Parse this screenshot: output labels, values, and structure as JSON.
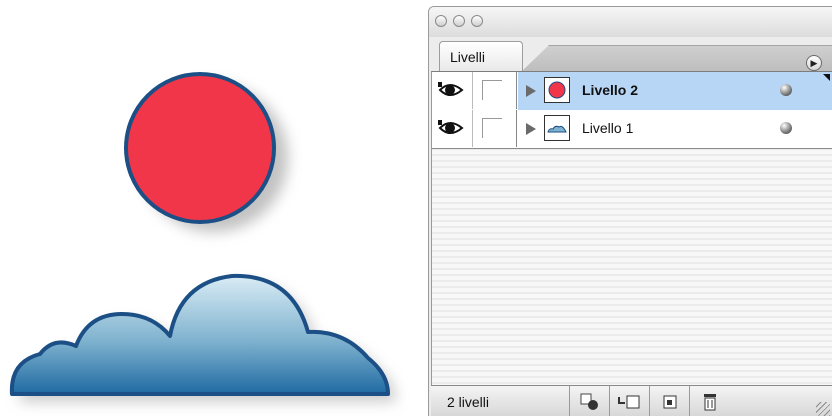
{
  "panel": {
    "tab_label": "Livelli",
    "layers": [
      {
        "name": "Livello 2",
        "selected": true,
        "thumbnail": "red-circle-icon",
        "visible": true
      },
      {
        "name": "Livello 1",
        "selected": false,
        "thumbnail": "cloud-icon",
        "visible": true
      }
    ],
    "status_count": "2 livelli",
    "footer_buttons": [
      "selection-target-icon",
      "new-layer-from-icon",
      "new-layer-icon",
      "trash-icon"
    ]
  },
  "colors": {
    "sun_fill": "#f2364a",
    "outline": "#1b4f86",
    "selection": "#b7d5f5"
  }
}
